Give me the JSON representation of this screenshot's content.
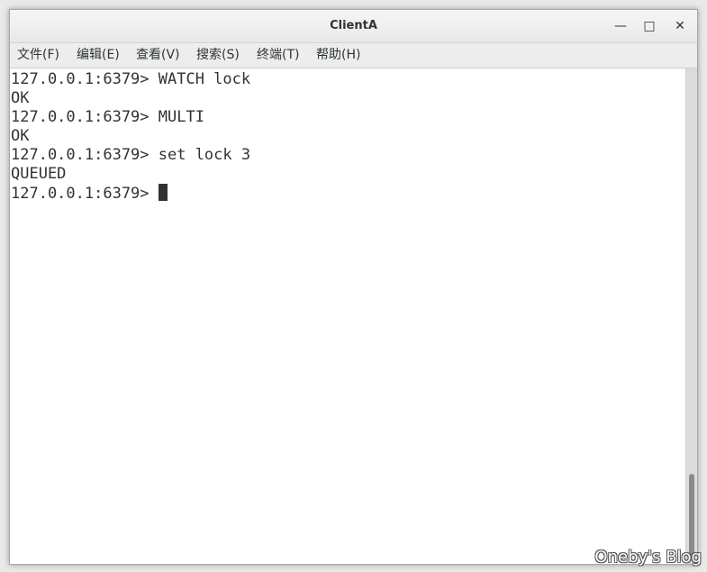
{
  "window": {
    "title": "ClientA",
    "minimize_glyph": "—",
    "maximize_glyph": "□",
    "close_glyph": "✕"
  },
  "menubar": {
    "items": [
      {
        "label": "文件(F)"
      },
      {
        "label": "编辑(E)"
      },
      {
        "label": "查看(V)"
      },
      {
        "label": "搜索(S)"
      },
      {
        "label": "终端(T)"
      },
      {
        "label": "帮助(H)"
      }
    ]
  },
  "terminal": {
    "lines": [
      "127.0.0.1:6379> WATCH lock",
      "OK",
      "127.0.0.1:6379> MULTI",
      "OK",
      "127.0.0.1:6379> set lock 3",
      "QUEUED"
    ],
    "prompt": "127.0.0.1:6379> "
  },
  "watermark": "Oneby's Blog"
}
